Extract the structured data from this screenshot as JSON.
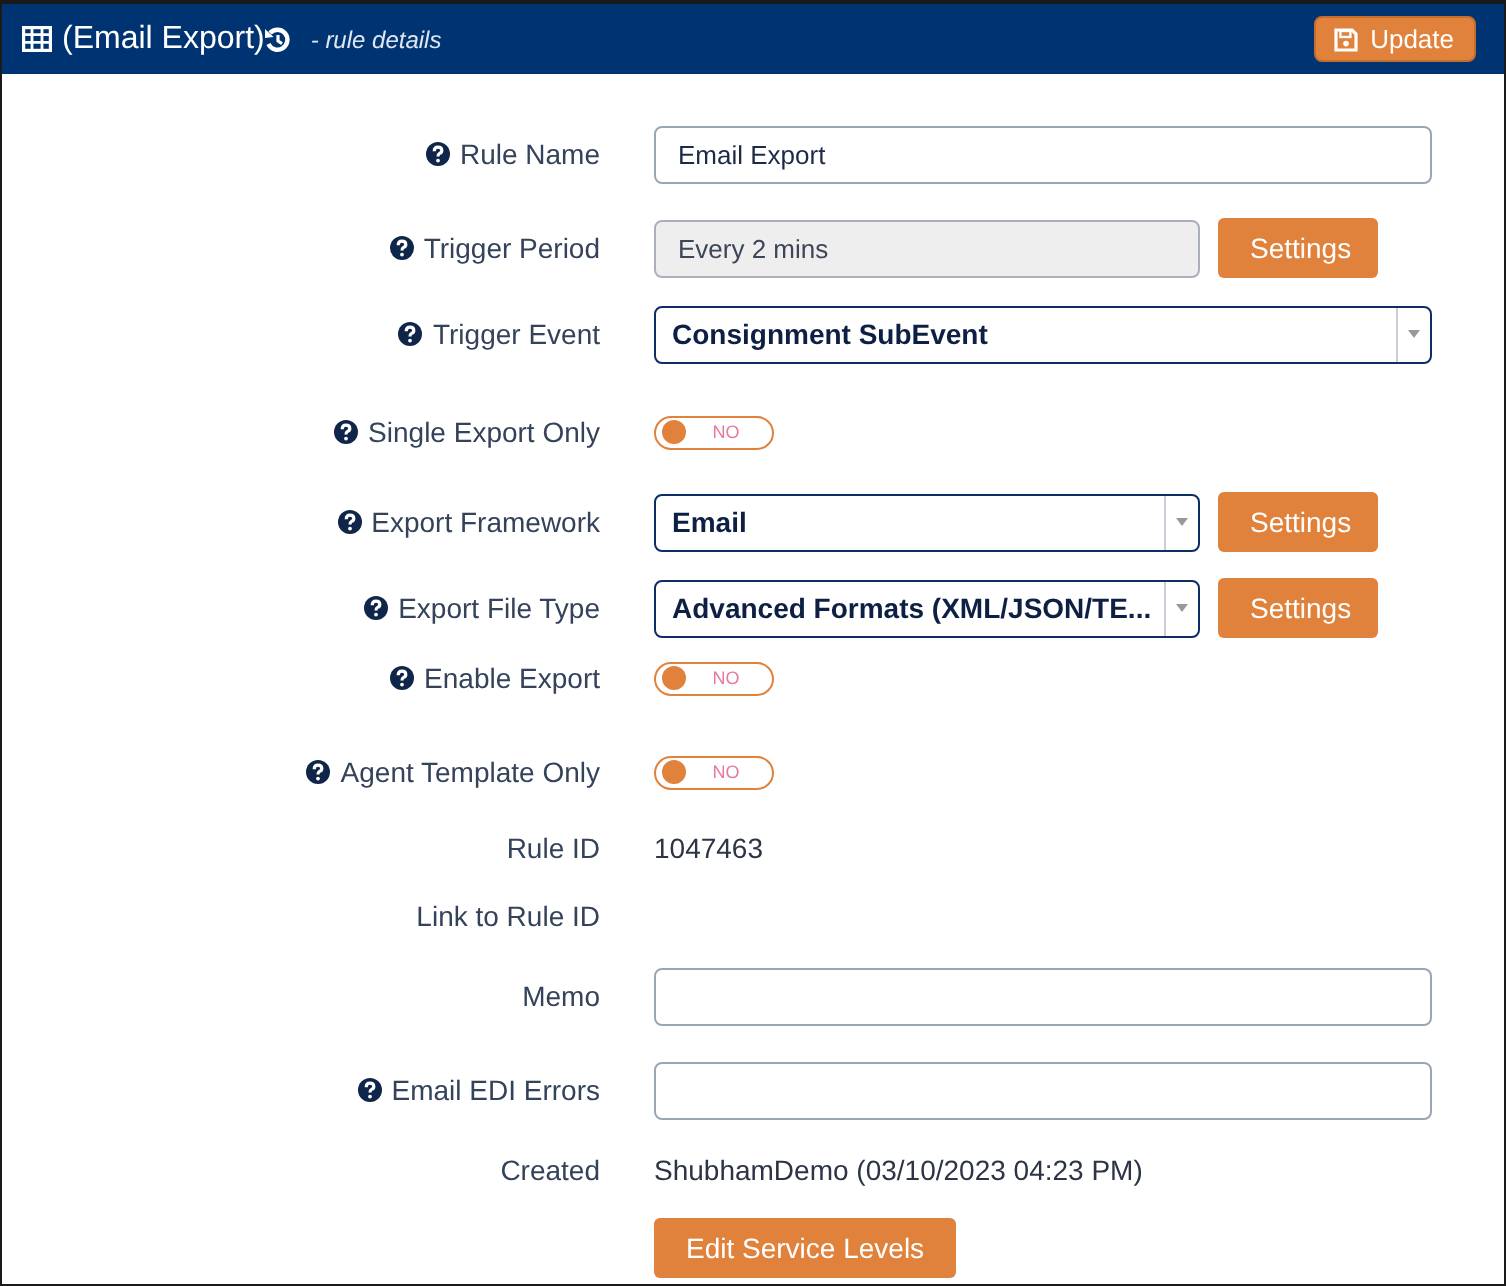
{
  "header": {
    "title": "(Email Export)",
    "subtitle": "- rule details",
    "update_button": "Update"
  },
  "fields": [
    {
      "kind": "input",
      "label": "Rule Name",
      "help": true,
      "value": "Email Export"
    },
    {
      "kind": "readonly",
      "label": "Trigger Period",
      "help": true,
      "value": "Every 2 mins",
      "button": "Settings"
    },
    {
      "kind": "select",
      "label": "Trigger Event",
      "help": true,
      "value": "Consignment SubEvent"
    },
    {
      "kind": "toggle",
      "label": "Single Export Only",
      "help": true,
      "on": false,
      "toggle_text": "NO"
    },
    {
      "kind": "select",
      "label": "Export Framework",
      "help": true,
      "value": "Email",
      "button": "Settings"
    },
    {
      "kind": "select",
      "label": "Export File Type",
      "help": true,
      "value": "Advanced Formats (XML/JSON/TE...",
      "button": "Settings"
    },
    {
      "kind": "toggle",
      "label": "Enable Export",
      "help": true,
      "on": false,
      "toggle_text": "NO"
    },
    {
      "kind": "toggle",
      "label": "Agent Template Only",
      "help": true,
      "on": false,
      "toggle_text": "NO"
    },
    {
      "kind": "text",
      "label": "Rule ID",
      "help": false,
      "value": "1047463"
    },
    {
      "kind": "text",
      "label": "Link to Rule ID",
      "help": false
    },
    {
      "kind": "input",
      "label": "Memo",
      "help": false
    },
    {
      "kind": "input",
      "label": "Email EDI Errors",
      "help": true
    },
    {
      "kind": "text",
      "label": "Created",
      "help": false,
      "value": "ShubhamDemo (03/10/2023 04:23 PM)"
    },
    {
      "kind": "button",
      "button": "Edit Service Levels"
    }
  ]
}
